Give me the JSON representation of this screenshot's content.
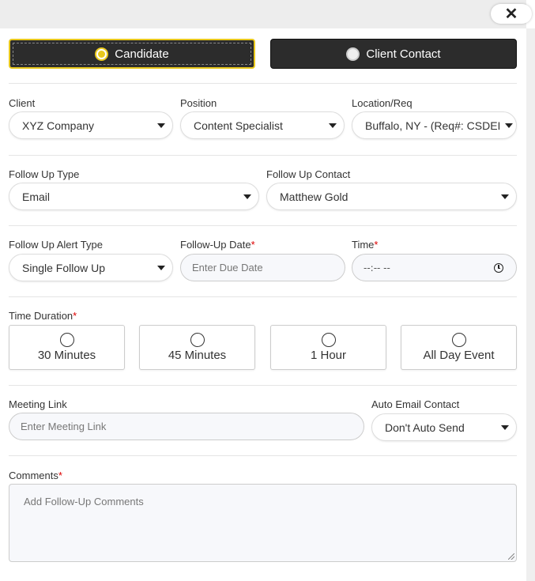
{
  "close_icon": "close-icon",
  "contact_type": {
    "candidate_label": "Candidate",
    "client_contact_label": "Client Contact",
    "selected": "Candidate",
    "accent_color": "#e8c81d"
  },
  "client": {
    "label": "Client",
    "value": "XYZ Company"
  },
  "position": {
    "label": "Position",
    "value": "Content Specialist"
  },
  "location": {
    "label": "Location/Req",
    "value": "Buffalo, NY - (Req#: CSDEI"
  },
  "follow_up_type": {
    "label": "Follow Up Type",
    "value": "Email"
  },
  "follow_up_contact": {
    "label": "Follow Up Contact",
    "value": "Matthew Gold"
  },
  "alert_type": {
    "label": "Follow Up Alert Type",
    "value": "Single Follow Up"
  },
  "follow_up_date": {
    "label": "Follow-Up Date",
    "required": "*",
    "placeholder": "Enter Due Date"
  },
  "time": {
    "label": "Time",
    "required": "*",
    "placeholder": "--:-- --"
  },
  "time_duration": {
    "label": "Time Duration",
    "required": "*",
    "options": [
      "30 Minutes",
      "45 Minutes",
      "1 Hour",
      "All Day Event"
    ]
  },
  "meeting_link": {
    "label": "Meeting Link",
    "placeholder": "Enter Meeting Link"
  },
  "auto_email": {
    "label": "Auto Email Contact",
    "value": "Don't Auto Send"
  },
  "comments": {
    "label": "Comments",
    "required": "*",
    "placeholder": "Add Follow-Up Comments"
  }
}
